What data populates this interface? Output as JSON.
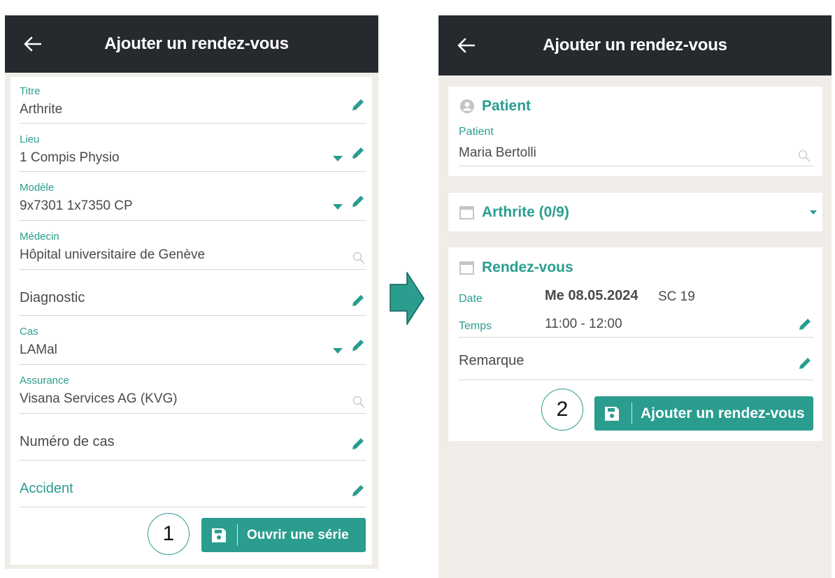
{
  "left": {
    "header": {
      "title": "Ajouter un rendez-vous",
      "back_icon": "arrow-left-icon"
    },
    "fields": {
      "titre": {
        "label": "Titre",
        "value": "Arthrite"
      },
      "lieu": {
        "label": "Lieu",
        "value": "1 Compis Physio"
      },
      "modele": {
        "label": "Modèle",
        "value": "9x7301 1x7350 CP"
      },
      "medecin": {
        "label": "Médecin",
        "value": "Hôpital universitaire de Genève"
      },
      "diagnostic": {
        "placeholder": "Diagnostic"
      },
      "cas": {
        "label": "Cas",
        "value": "LAMal"
      },
      "assurance": {
        "label": "Assurance",
        "value": "Visana Services AG (KVG)"
      },
      "numero": {
        "placeholder": "Numéro de cas"
      },
      "accident": {
        "placeholder": "Accident"
      }
    },
    "button": {
      "label": "Ouvrir une série",
      "icon": "save-icon"
    },
    "badge": "1"
  },
  "right": {
    "header": {
      "title": "Ajouter un rendez-vous",
      "back_icon": "arrow-left-icon"
    },
    "patient_section": {
      "heading": "Patient",
      "label": "Patient",
      "value": "Maria Bertolli",
      "icon": "person-circle-icon"
    },
    "series_section": {
      "heading": "Arthrite (0/9)",
      "icon": "calendar-icon"
    },
    "rdv_section": {
      "heading": "Rendez-vous",
      "date_label": "Date",
      "date_value": "Me 08.05.2024",
      "date_extra": "SC 19",
      "time_label": "Temps",
      "time_value": "11:00 - 12:00",
      "remark_placeholder": "Remarque"
    },
    "button": {
      "label": "Ajouter un rendez-vous",
      "icon": "save-icon"
    },
    "badge": "2"
  },
  "colors": {
    "accent": "#2a9d8f",
    "appbar": "#262a2e",
    "background": "#f0ede9"
  }
}
